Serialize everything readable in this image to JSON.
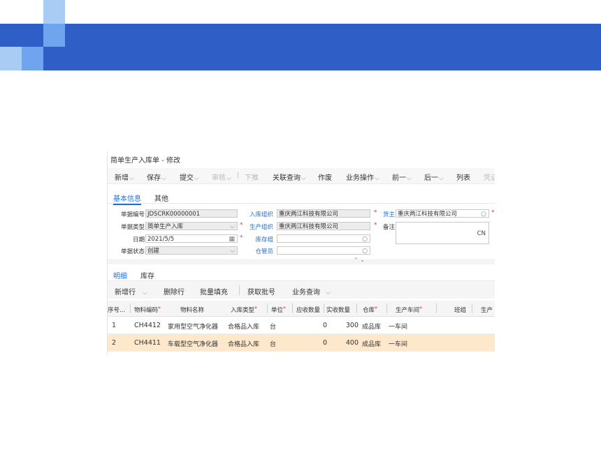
{
  "colors": {
    "banner": "#2f5fc6",
    "square_light": "#a9ccf4",
    "square_mid": "#6fa4ef",
    "accent": "#1f6fd6",
    "required": "#e0382f",
    "selected_row": "#fde8cc"
  },
  "window": {
    "title": "简单生产入库单 - 修改"
  },
  "toolbar": [
    {
      "label": "新增",
      "chevron": "⌵"
    },
    {
      "label": "保存",
      "chevron": "⌵"
    },
    {
      "label": "提交",
      "chevron": "⌵"
    },
    {
      "label": "审核",
      "chevron": "⌵"
    },
    {
      "label": "|"
    },
    {
      "label": "下推"
    },
    {
      "label": "关联查询",
      "chevron": "⌵"
    },
    {
      "label": "作废"
    },
    {
      "label": "业务操作",
      "chevron": "⌵"
    },
    {
      "label": "前一",
      "chevron": "⌵"
    },
    {
      "label": "后一",
      "chevron": "⌵"
    },
    {
      "label": "列表"
    },
    {
      "label": "凭证"
    }
  ],
  "header_tabs": [
    "基本信息",
    "其他"
  ],
  "form": {
    "bill_no": {
      "label": "单据编号",
      "value": "JDSCRK00000001"
    },
    "bill_type": {
      "label": "单据类型",
      "value": "简单生产入库"
    },
    "date": {
      "label": "日期",
      "value": "2021/5/5"
    },
    "status": {
      "label": "单据状态",
      "value": "创建"
    },
    "stock_org": {
      "label": "入库组织",
      "value": "重庆两江科技有限公司"
    },
    "prd_org": {
      "label": "生产组织",
      "value": "重庆两江科技有限公司"
    },
    "stock_group": {
      "label": "库存组",
      "value": ""
    },
    "keeper": {
      "label": "仓管员",
      "value": ""
    },
    "owner": {
      "label": "货主",
      "value": "重庆两江科技有限公司"
    },
    "note": {
      "label": "备注",
      "value": "",
      "lang": "CN"
    },
    "required_mark": "*"
  },
  "collapse_glyph": "⌃ ⌄",
  "detail_tabs": [
    "明细",
    "库存"
  ],
  "detail_toolbar": [
    {
      "label": "新增行",
      "chevron": "⌵"
    },
    {
      "label": "删除行"
    },
    {
      "label": "批量填充"
    },
    {
      "label": "获取批号"
    },
    {
      "label": "业务查询",
      "chevron": "⌵"
    }
  ],
  "columns": [
    "序号...",
    "物料编码",
    "物料名称",
    "入库类型",
    "单位",
    "应收数量",
    "实收数量",
    "仓库",
    "生产车间",
    "班组",
    "生产"
  ],
  "rows": [
    {
      "seq": "1",
      "code": "CH4412",
      "name": "家用型空气净化器",
      "type": "合格品入库",
      "unit": "台",
      "due_qty": "0",
      "real_qty": "300",
      "stock": "成品库",
      "workshop": "一车间"
    },
    {
      "seq": "2",
      "code": "CH4411",
      "name": "车载型空气净化器",
      "type": "合格品入库",
      "unit": "台",
      "due_qty": "0",
      "real_qty": "400",
      "stock": "成品库",
      "workshop": "一车间"
    }
  ],
  "icons": {
    "search": "search-icon",
    "calendar": "calendar-icon",
    "dropdown": "chevron-down-icon"
  }
}
